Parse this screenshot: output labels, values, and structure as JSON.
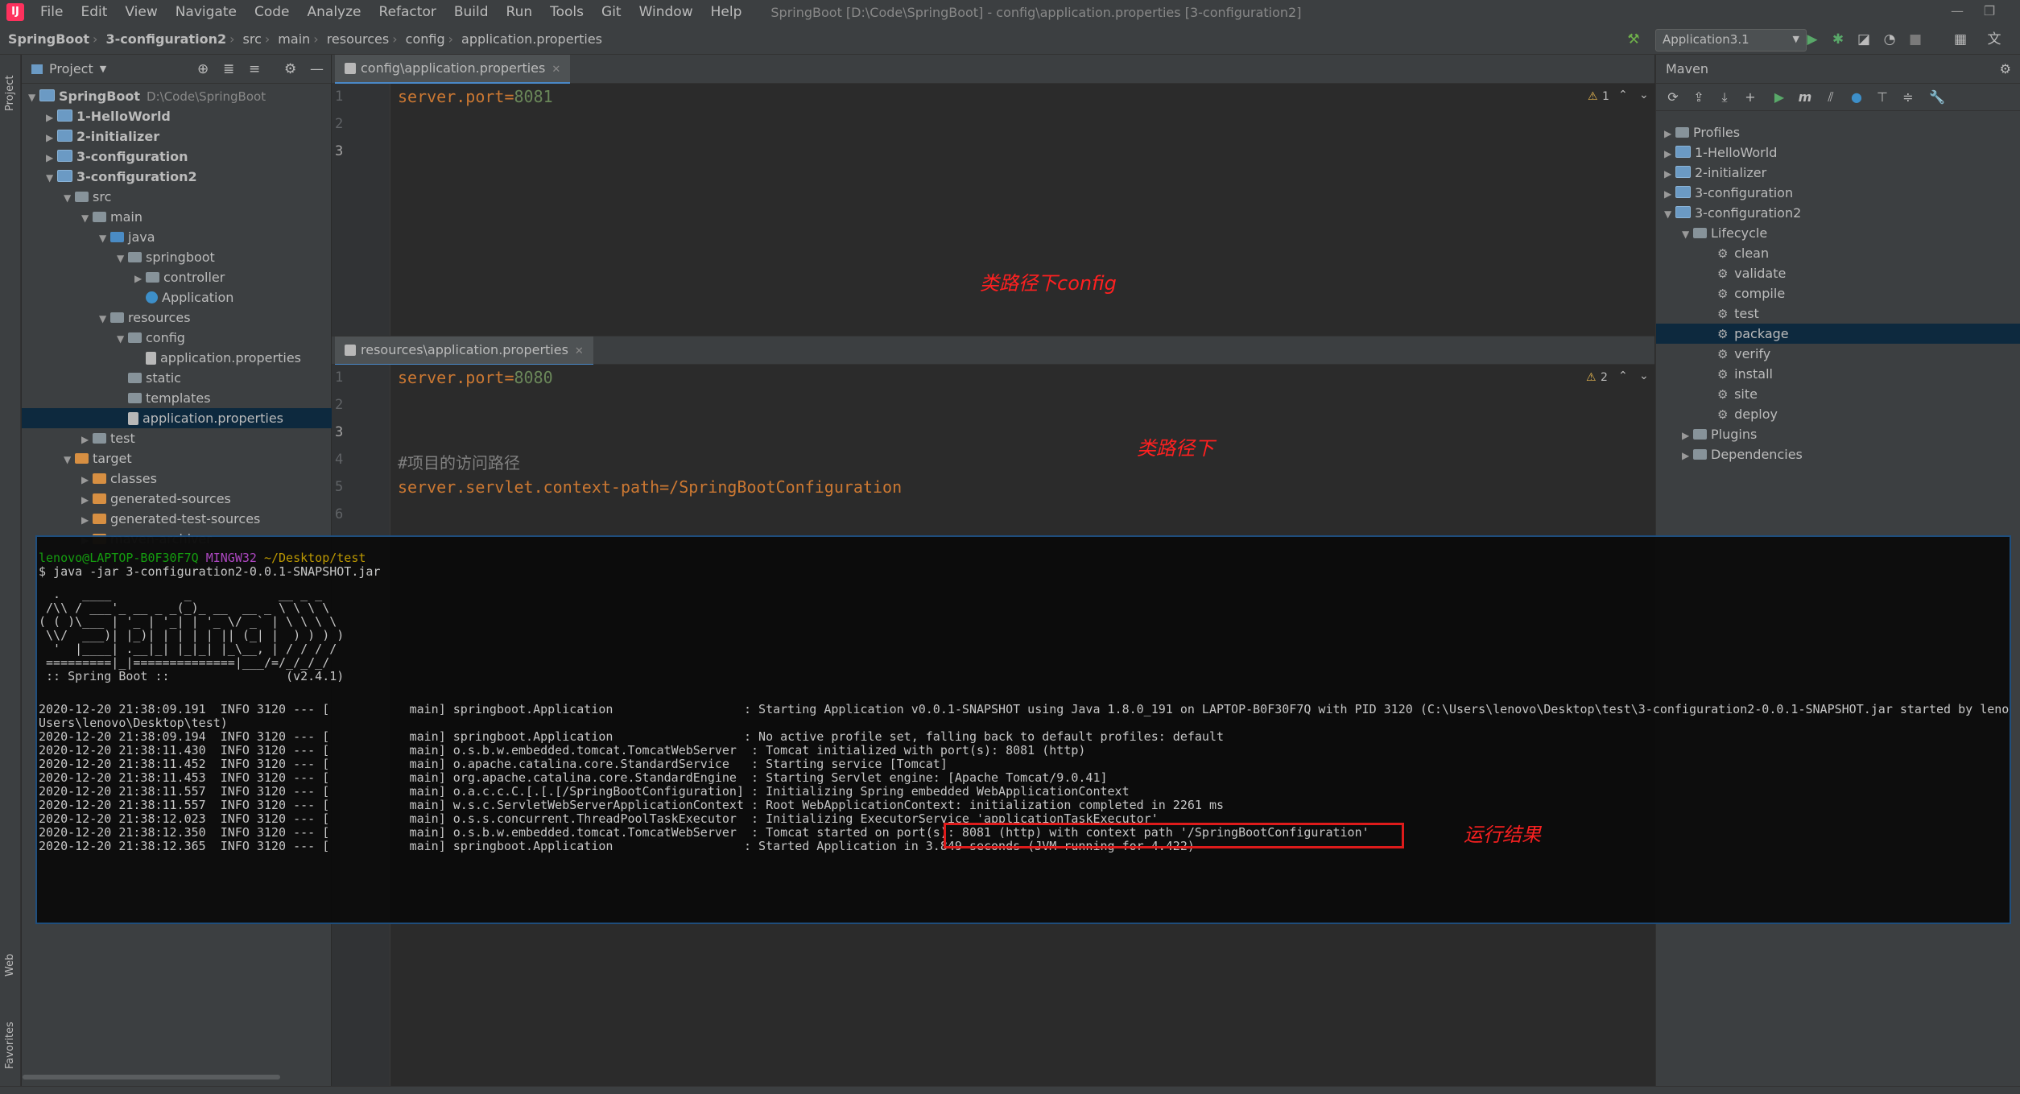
{
  "menubar": {
    "items": [
      "File",
      "Edit",
      "View",
      "Navigate",
      "Code",
      "Analyze",
      "Refactor",
      "Build",
      "Run",
      "Tools",
      "Git",
      "Window",
      "Help"
    ],
    "window_title": "SpringBoot [D:\\Code\\SpringBoot] - config\\application.properties [3-configuration2]"
  },
  "breadcrumb": [
    "SpringBoot",
    "3-configuration2",
    "src",
    "main",
    "resources",
    "config",
    "application.properties"
  ],
  "toolbar": {
    "run_config": "Application3.1"
  },
  "left_stripe": {
    "project": "Project",
    "web": "Web",
    "favorites": "Favorites"
  },
  "project_panel": {
    "title": "Project",
    "tree": [
      {
        "label": "SpringBoot",
        "extra": "D:\\Code\\SpringBoot",
        "arrow": "▼",
        "bold": true
      },
      {
        "label": "1-HelloWorld",
        "arrow": "▶",
        "bold": true
      },
      {
        "label": "2-initializer",
        "arrow": "▶",
        "bold": true
      },
      {
        "label": "3-configuration",
        "arrow": "▶",
        "bold": true
      },
      {
        "label": "3-configuration2",
        "arrow": "▼",
        "bold": true
      },
      {
        "label": "src",
        "arrow": "▼"
      },
      {
        "label": "main",
        "arrow": "▼"
      },
      {
        "label": "java",
        "arrow": "▼"
      },
      {
        "label": "springboot",
        "arrow": "▼"
      },
      {
        "label": "controller",
        "arrow": "▶"
      },
      {
        "label": "Application",
        "arrow": ""
      },
      {
        "label": "resources",
        "arrow": "▼"
      },
      {
        "label": "config",
        "arrow": "▼"
      },
      {
        "label": "application.properties",
        "arrow": ""
      },
      {
        "label": "static",
        "arrow": ""
      },
      {
        "label": "templates",
        "arrow": ""
      },
      {
        "label": "application.properties",
        "arrow": ""
      },
      {
        "label": "test",
        "arrow": "▶"
      },
      {
        "label": "target",
        "arrow": "▼"
      },
      {
        "label": "classes",
        "arrow": "▶"
      },
      {
        "label": "generated-sources",
        "arrow": "▶"
      },
      {
        "label": "generated-test-sources",
        "arrow": "▶"
      },
      {
        "label": "maven-archiver",
        "arrow": "▶"
      }
    ]
  },
  "editor_top": {
    "tab": "config\\application.properties",
    "lines": [
      "1",
      "2",
      "3"
    ],
    "code": {
      "key": "server.port=",
      "value": "8081"
    },
    "warning": "1",
    "annotation": "类路径下config"
  },
  "editor_bottom": {
    "tab": "resources\\application.properties",
    "lines": [
      "1",
      "2",
      "3",
      "4",
      "5",
      "6"
    ],
    "code": {
      "key": "server.port=",
      "value": "8080"
    },
    "comment": "#项目的访问路径",
    "context": "server.servlet.context-path=/SpringBootConfiguration",
    "warning": "2",
    "annotation": "类路径下"
  },
  "maven": {
    "title": "Maven",
    "tree": [
      {
        "label": "Profiles",
        "arrow": "▶",
        "depth": 0
      },
      {
        "label": "1-HelloWorld",
        "arrow": "▶",
        "depth": 0
      },
      {
        "label": "2-initializer",
        "arrow": "▶",
        "depth": 0
      },
      {
        "label": "3-configuration",
        "arrow": "▶",
        "depth": 0
      },
      {
        "label": "3-configuration2",
        "arrow": "▼",
        "depth": 0
      },
      {
        "label": "Lifecycle",
        "arrow": "▼",
        "depth": 1
      },
      {
        "label": "clean",
        "arrow": "",
        "depth": 2
      },
      {
        "label": "validate",
        "arrow": "",
        "depth": 2
      },
      {
        "label": "compile",
        "arrow": "",
        "depth": 2
      },
      {
        "label": "test",
        "arrow": "",
        "depth": 2
      },
      {
        "label": "package",
        "arrow": "",
        "depth": 2
      },
      {
        "label": "verify",
        "arrow": "",
        "depth": 2
      },
      {
        "label": "install",
        "arrow": "",
        "depth": 2
      },
      {
        "label": "site",
        "arrow": "",
        "depth": 2
      },
      {
        "label": "deploy",
        "arrow": "",
        "depth": 2
      },
      {
        "label": "Plugins",
        "arrow": "▶",
        "depth": 1
      },
      {
        "label": "Dependencies",
        "arrow": "▶",
        "depth": 1
      }
    ],
    "selected": "package"
  },
  "terminal": {
    "prompt_user": "lenovo@LAPTOP-B0F30F7Q",
    "prompt_env": "MINGW32",
    "prompt_path": "~/Desktop/test",
    "command": "$ java -jar 3-configuration2-0.0.1-SNAPSHOT.jar",
    "banner": [
      "  .   ____          _            __ _ _",
      " /\\\\ / ___'_ __ _ _(_)_ __  __ _ \\ \\ \\ \\",
      "( ( )\\___ | '_ | '_| | '_ \\/ _` | \\ \\ \\ \\",
      " \\\\/  ___)| |_)| | | | | || (_| |  ) ) ) )",
      "  '  |____| .__|_| |_|_| |_\\__, | / / / /",
      " =========|_|==============|___/=/_/_/_/",
      " :: Spring Boot ::                (v2.4.1)"
    ],
    "logs": [
      "2020-12-20 21:38:09.191  INFO 3120 --- [           main] springboot.Application                  : Starting Application v0.0.1-SNAPSHOT using Java 1.8.0_191 on LAPTOP-B0F30F7Q with PID 3120 (C:\\Users\\lenovo\\Desktop\\test\\3-configuration2-0.0.1-SNAPSHOT.jar started by lenovo in C:\\",
      "Users\\lenovo\\Desktop\\test)",
      "2020-12-20 21:38:09.194  INFO 3120 --- [           main] springboot.Application                  : No active profile set, falling back to default profiles: default",
      "2020-12-20 21:38:11.430  INFO 3120 --- [           main] o.s.b.w.embedded.tomcat.TomcatWebServer  : Tomcat initialized with port(s): 8081 (http)",
      "2020-12-20 21:38:11.452  INFO 3120 --- [           main] o.apache.catalina.core.StandardService   : Starting service [Tomcat]",
      "2020-12-20 21:38:11.453  INFO 3120 --- [           main] org.apache.catalina.core.StandardEngine  : Starting Servlet engine: [Apache Tomcat/9.0.41]",
      "2020-12-20 21:38:11.557  INFO 3120 --- [           main] o.a.c.c.C.[.[.[/SpringBootConfiguration] : Initializing Spring embedded WebApplicationContext",
      "2020-12-20 21:38:11.557  INFO 3120 --- [           main] w.s.c.ServletWebServerApplicationContext : Root WebApplicationContext: initialization completed in 2261 ms",
      "2020-12-20 21:38:12.023  INFO 3120 --- [           main] o.s.s.concurrent.ThreadPoolTaskExecutor  : Initializing ExecutorService 'applicationTaskExecutor'",
      "2020-12-20 21:38:12.350  INFO 3120 --- [           main] o.s.b.w.embedded.tomcat.TomcatWebServer  : Tomcat started on port(s): 8081 (http) with context path '/SpringBootConfiguration'",
      "2020-12-20 21:38:12.365  INFO 3120 --- [           main] springboot.Application                  : Started Application in 3.849 seconds (JVM running for 4.422)"
    ],
    "annotation": "运行结果"
  },
  "colors": {
    "annotation": "#ff2020",
    "selection": "#0d293e",
    "accent": "#4a88c7",
    "string_value": "#6a8759",
    "keyword": "#cc7832"
  }
}
